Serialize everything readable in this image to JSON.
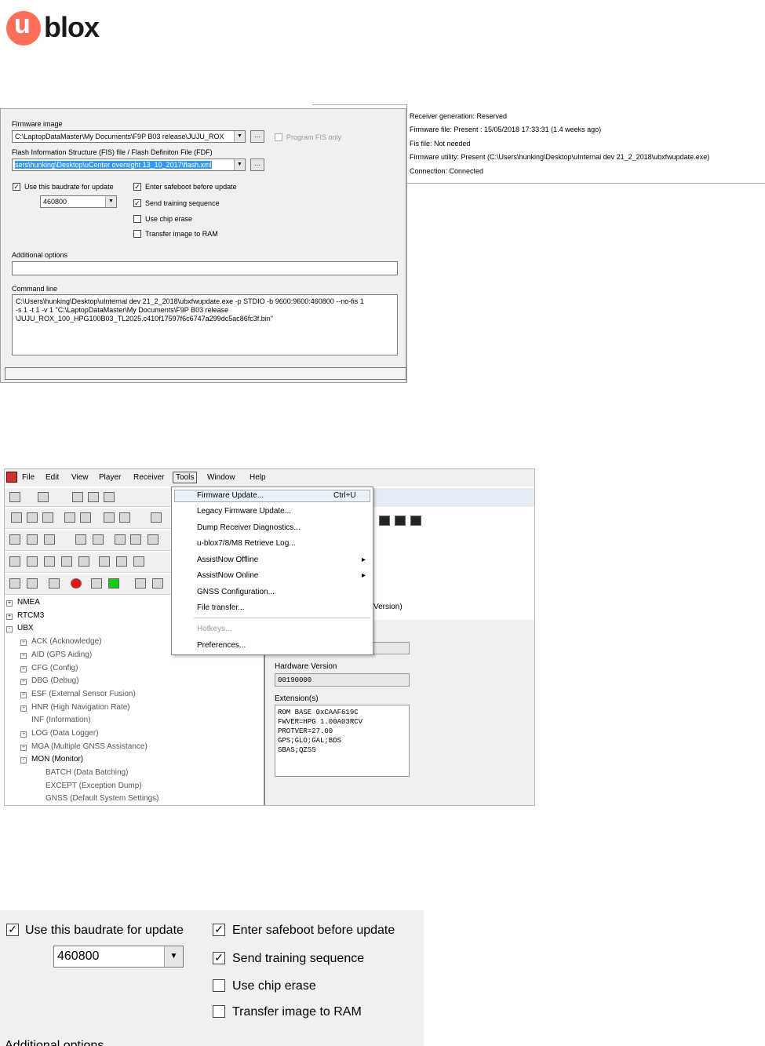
{
  "logo": {
    "text": "blox",
    "letter": "u"
  },
  "p1": {
    "firmware_image_label": "Firmware image",
    "firmware_image_value": "C:\\LaptopDataMaster\\My Documents\\F9P B03 release\\JUJU_ROX",
    "program_fis_only": "Program FIS only",
    "fis_label": "Flash Information Structure (FIS) file / Flash Definiton File (FDF)",
    "fis_value": "sers\\hunking\\Desktop\\uCenter oversight 13_10_2017\\flash.xml",
    "use_baudrate": "Use this baudrate for update",
    "baudrate": "460800",
    "enter_safeboot": "Enter safeboot before update",
    "send_training": "Send training sequence",
    "use_chip_erase": "Use chip erase",
    "transfer_ram": "Transfer image to RAM",
    "additional_options_label": "Additional options",
    "command_line_label": "Command line",
    "command_line": "C:\\Users\\hunking\\Desktop\\uInternal dev 21_2_2018\\ubxfwupdate.exe -p STDIO -b 9600:9600:460800 --no-fis 1\n-s 1 -t 1 -v 1 \"C:\\LaptopDataMaster\\My Documents\\F9P B03 release\n\\JUJU_ROX_100_HPG100B03_TL2025.c410f17597f6c6747a299dc5ac86fc3f.bin\"",
    "info": [
      "Receiver generation: Reserved",
      "Firmware file: Present : 15/05/2018  17:33:31 (1.4 weeks ago)",
      "Fis file: Not needed",
      "Firmware utility: Present (C:\\Users\\hunking\\Desktop\\uInternal dev 21_2_2018\\ubxfwupdate.exe)",
      "Connection: Connected"
    ]
  },
  "p2": {
    "menu": [
      "File",
      "Edit",
      "View",
      "Player",
      "Receiver",
      "Tools",
      "Window",
      "Help"
    ],
    "dropdown": [
      {
        "label": "Firmware Update...",
        "shortcut": "Ctrl+U"
      },
      {
        "label": "Legacy Firmware Update..."
      },
      {
        "label": "Dump Receiver Diagnostics..."
      },
      {
        "label": "u-blox7/8/M8 Retrieve Log..."
      },
      {
        "label": "AssistNow Offline",
        "sub": "▸"
      },
      {
        "label": "AssistNow Online",
        "sub": "▸"
      },
      {
        "label": "GNSS Configuration..."
      },
      {
        "label": "File transfer..."
      },
      {
        "label": "Hotkeys..."
      },
      {
        "label": "Preferences..."
      }
    ],
    "tree": [
      {
        "label": "NMEA",
        "level": 0,
        "exp": "+"
      },
      {
        "label": "RTCM3",
        "level": 0,
        "exp": "+"
      },
      {
        "label": "UBX",
        "level": 0,
        "exp": "-"
      },
      {
        "label": "ACK (Acknowledge)",
        "level": 1,
        "exp": "+"
      },
      {
        "label": "AID (GPS Aiding)",
        "level": 1,
        "exp": "+"
      },
      {
        "label": "CFG (Config)",
        "level": 1,
        "exp": "+"
      },
      {
        "label": "DBG (Debug)",
        "level": 1,
        "exp": "+"
      },
      {
        "label": "ESF (External Sensor Fusion)",
        "level": 1,
        "exp": "+"
      },
      {
        "label": "HNR (High Navigation Rate)",
        "level": 1,
        "exp": "+"
      },
      {
        "label": "INF (Information)",
        "level": 1,
        "exp": ""
      },
      {
        "label": "LOG (Data Logger)",
        "level": 1,
        "exp": "+"
      },
      {
        "label": "MGA (Multiple GNSS Assistance)",
        "level": 1,
        "exp": "+"
      },
      {
        "label": "MON (Monitor)",
        "level": 1,
        "exp": "-"
      },
      {
        "label": "BATCH (Data Batching)",
        "level": 2,
        "exp": ""
      },
      {
        "label": "EXCEPT (Exception Dump)",
        "level": 2,
        "exp": ""
      },
      {
        "label": "GNSS (Default System Settings)",
        "level": 2,
        "exp": ""
      }
    ],
    "version_label": "Version)",
    "hardware_version_label": "Hardware Version",
    "hardware_version": "00190000",
    "extensions_label": "Extension(s)",
    "extensions": "ROM BASE 0xCAAF619C\nFWVER=HPG 1.00A03RCV\nPROTVER=27.00\nGPS;GLO;GAL;BDS\nSBAS;QZSS"
  },
  "p3": {
    "use_baudrate": "Use this baudrate for update",
    "baudrate": "460800",
    "enter_safeboot": "Enter safeboot before update",
    "send_training": "Send training sequence",
    "use_chip_erase": "Use chip erase",
    "transfer_ram": "Transfer image to RAM",
    "cut_label": "Additional options"
  }
}
